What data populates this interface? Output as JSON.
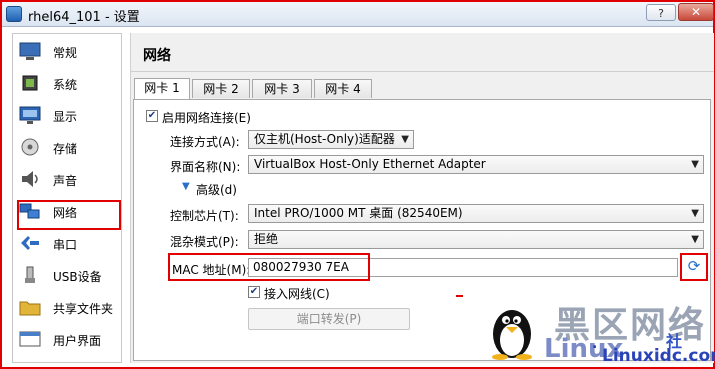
{
  "window": {
    "title": "rhel64_101 - 设置",
    "help_label": "?",
    "close_label": "✕"
  },
  "sidebar": {
    "items": [
      {
        "label": "常规",
        "icon": "general-icon"
      },
      {
        "label": "系统",
        "icon": "system-chip-icon"
      },
      {
        "label": "显示",
        "icon": "display-monitor-icon"
      },
      {
        "label": "存储",
        "icon": "storage-disk-icon"
      },
      {
        "label": "声音",
        "icon": "speaker-icon"
      },
      {
        "label": "网络",
        "icon": "network-icon",
        "selected": true
      },
      {
        "label": "串口",
        "icon": "serial-port-icon"
      },
      {
        "label": "USB设备",
        "icon": "usb-icon"
      },
      {
        "label": "共享文件夹",
        "icon": "shared-folder-icon"
      },
      {
        "label": "用户界面",
        "icon": "user-interface-icon"
      }
    ]
  },
  "main": {
    "title": "网络",
    "tabs": [
      {
        "label": "网卡 1",
        "active": true
      },
      {
        "label": "网卡 2"
      },
      {
        "label": "网卡 3"
      },
      {
        "label": "网卡 4"
      }
    ],
    "enable_adapter": {
      "label": "启用网络连接(E)",
      "checked": true
    },
    "attached_to": {
      "label": "连接方式(A):",
      "value": "仅主机(Host-Only)适配器"
    },
    "name": {
      "label": "界面名称(N):",
      "value": "VirtualBox Host-Only Ethernet Adapter"
    },
    "advanced": {
      "label": "高级(d)"
    },
    "adapter_type": {
      "label": "控制芯片(T):",
      "value": "Intel PRO/1000 MT 桌面 (82540EM)"
    },
    "promiscuous": {
      "label": "混杂模式(P):",
      "value": "拒绝"
    },
    "mac": {
      "label": "MAC 地址(M):",
      "value": "080027930 7EA"
    },
    "cable": {
      "label": "接入网线(C)",
      "checked": true
    },
    "port_forwarding": {
      "label": "端口转发(P)"
    }
  },
  "watermark": {
    "cn": "黑区网络",
    "en": "Linux",
    "url": "Linuxidc.com",
    "she": "社",
    "dot": "."
  },
  "colors": {
    "highlight": "#e00000",
    "accent": "#2a6fc9"
  }
}
